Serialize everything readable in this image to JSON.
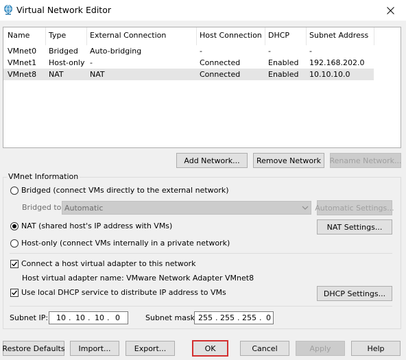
{
  "window": {
    "title": "Virtual Network Editor"
  },
  "table": {
    "headers": [
      "Name",
      "Type",
      "External Connection",
      "Host Connection",
      "DHCP",
      "Subnet Address"
    ],
    "rows": [
      [
        "VMnet0",
        "Bridged",
        "Auto-bridging",
        "-",
        "-",
        "-"
      ],
      [
        "VMnet1",
        "Host-only",
        "-",
        "Connected",
        "Enabled",
        "192.168.202.0"
      ],
      [
        "VMnet8",
        "NAT",
        "NAT",
        "Connected",
        "Enabled",
        "10.10.10.0"
      ]
    ]
  },
  "network_buttons": {
    "add": "Add Network...",
    "remove": "Remove Network",
    "rename": "Rename Network..."
  },
  "vmnet_info": {
    "title": "VMnet Information",
    "bridged_label": "Bridged (connect VMs directly to the external network)",
    "bridged_to_label": "Bridged to:",
    "bridged_to_value": "Automatic",
    "auto_settings": "Automatic Settings...",
    "nat_label": "NAT (shared host's IP address with VMs)",
    "nat_settings": "NAT Settings...",
    "hostonly_label": "Host-only (connect VMs internally in a private network)",
    "connect_adapter_label": "Connect a host virtual adapter to this network",
    "adapter_name_label": "Host virtual adapter name: VMware Network Adapter VMnet8",
    "dhcp_label": "Use local DHCP service to distribute IP address to VMs",
    "dhcp_settings": "DHCP Settings...",
    "subnet_ip_label": "Subnet IP:",
    "subnet_ip": [
      "10",
      "10",
      "10",
      "0"
    ],
    "subnet_mask_label": "Subnet mask:",
    "subnet_mask": [
      "255",
      "255",
      "255",
      "0"
    ]
  },
  "footer": {
    "restore": "Restore Defaults",
    "import": "Import...",
    "export": "Export...",
    "ok": "OK",
    "cancel": "Cancel",
    "apply": "Apply",
    "help": "Help"
  },
  "colors": {
    "highlight": "#d32f2f",
    "selected_row": "#e5e5e5"
  },
  "icons": {
    "app": "globe-icon",
    "close": "close-icon",
    "dropdown": "chevron-down-icon"
  }
}
